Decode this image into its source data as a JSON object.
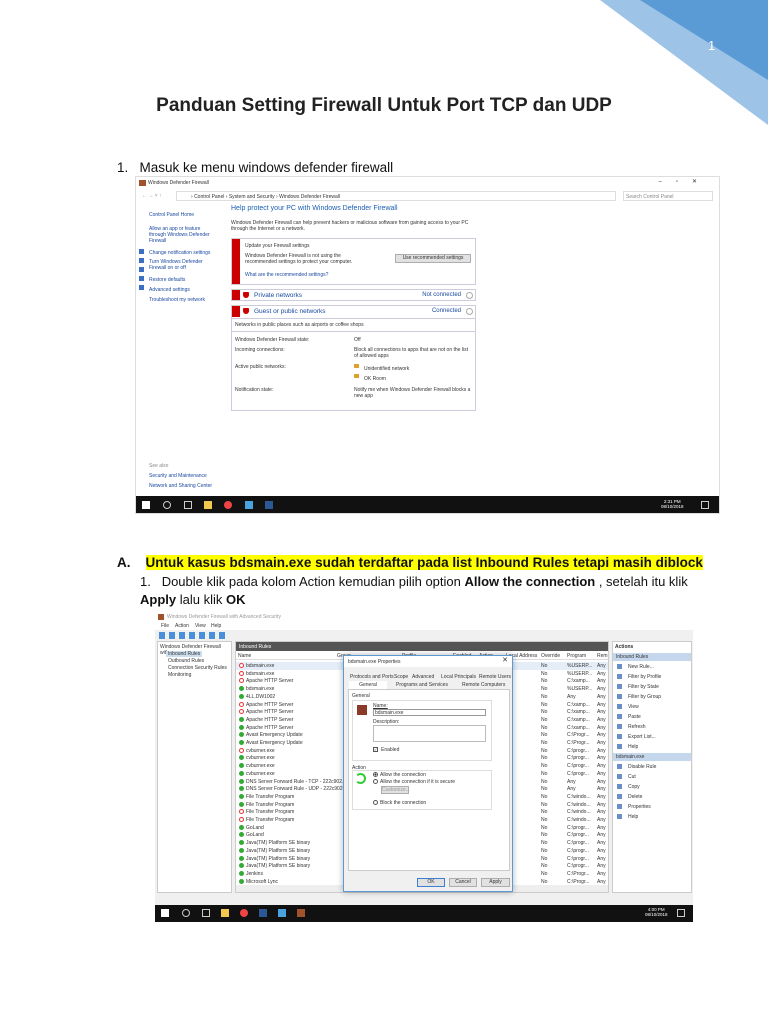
{
  "page_number": "1",
  "title": "Panduan Setting Firewall Untuk Port TCP dan UDP",
  "step1": {
    "num": "1.",
    "text": "Masuk ke menu windows defender firewall"
  },
  "shot1": {
    "window_title": "Windows Defender Firewall",
    "breadcrumb": [
      "Control Panel",
      "System and Security",
      "Windows Defender Firewall"
    ],
    "search_placeholder": "Search Control Panel",
    "window_controls": [
      "–",
      "▫",
      "✕"
    ],
    "left_links": [
      "Control Panel Home",
      "Allow an app or feature through Windows Defender Firewall",
      "Change notification settings",
      "Turn Windows Defender Firewall on or off",
      "Restore defaults",
      "Advanced settings",
      "Troubleshoot my network"
    ],
    "see_also": "See also",
    "see_also_links": [
      "Security and Maintenance",
      "Network and Sharing Center"
    ],
    "heading": "Help protect your PC with Windows Defender Firewall",
    "intro": "Windows Defender Firewall can help prevent hackers or malicious software from gaining access to your PC through the Internet or a network.",
    "warn_title": "Update your Firewall settings",
    "warn_text": "Windows Defender Firewall is not using the recommended settings to protect your computer.",
    "warn_button": "Use recommended settings",
    "warn_link": "What are the recommended settings?",
    "private": {
      "label": "Private networks",
      "status": "Not connected"
    },
    "public": {
      "label": "Guest or public networks",
      "status": "Connected"
    },
    "public_desc": "Networks in public places such as airports or coffee shops",
    "details": [
      {
        "k": "Windows Defender Firewall state:",
        "v": "Off"
      },
      {
        "k": "Incoming connections:",
        "v": "Block all connections to apps that are not on the list of allowed apps"
      },
      {
        "k": "Active public networks:",
        "v": "Unidentified network"
      },
      {
        "k": "",
        "v": "OK Room"
      },
      {
        "k": "Notification state:",
        "v": "Notify me when Windows Defender Firewall blocks a new app"
      }
    ],
    "clock": {
      "time": "2:31 PM",
      "date": "08/10/2018"
    }
  },
  "sectionA": {
    "letter": "A.",
    "text": "Untuk kasus bdsmain.exe sudah terdaftar pada list Inbound Rules tetapi masih diblock"
  },
  "stepA1": {
    "num": "1.",
    "t1": "Double klik pada kolom Action kemudian pilih option ",
    "b1": "Allow the connection",
    "t2": " , setelah itu klik ",
    "b2": "Apply",
    "t3": " lalu klik ",
    "b3": "OK"
  },
  "shot2": {
    "window_title": "Windows Defender Firewall with Advanced Security",
    "menu": [
      "File",
      "Action",
      "View",
      "Help"
    ],
    "tree": [
      "Windows Defender Firewall with",
      "Inbound Rules",
      "Outbound Rules",
      "Connection Security Rules",
      "Monitoring"
    ],
    "pane_title": "Inbound Rules",
    "columns": [
      "Name",
      "Group",
      "Profile",
      "Enabled",
      "Action",
      "Local Address",
      "Override",
      "Program",
      "Rem"
    ],
    "rules": [
      {
        "name": "bdsmain.exe",
        "s": "block",
        "prog": "%USERP..."
      },
      {
        "name": "bdsmain.exe",
        "s": "block",
        "prog": "%USERP..."
      },
      {
        "name": "Apache HTTP Server",
        "s": "block",
        "prog": "C:\\xamp..."
      },
      {
        "name": "bdsmain.exe",
        "s": "allow",
        "prog": "%USERP..."
      },
      {
        "name": "4LL.DW1002",
        "s": "allow",
        "prog": "Any"
      },
      {
        "name": "Apache HTTP Server",
        "s": "block",
        "prog": "C:\\xamp..."
      },
      {
        "name": "Apache HTTP Server",
        "s": "block",
        "prog": "C:\\xamp..."
      },
      {
        "name": "Apache HTTP Server",
        "s": "allow",
        "prog": "C:\\xamp..."
      },
      {
        "name": "Apache HTTP Server",
        "s": "allow",
        "prog": "C:\\xamp..."
      },
      {
        "name": "Avast Emergency Update",
        "s": "allow",
        "prog": "C:\\Progr..."
      },
      {
        "name": "Avast Emergency Update",
        "s": "allow",
        "prog": "C:\\Progr..."
      },
      {
        "name": "cvburner.exe",
        "s": "block",
        "prog": "C:\\progr..."
      },
      {
        "name": "cvburner.exe",
        "s": "allow",
        "prog": "C:\\progr..."
      },
      {
        "name": "cvburner.exe",
        "s": "allow",
        "prog": "C:\\progr..."
      },
      {
        "name": "cvburner.exe",
        "s": "allow",
        "prog": "C:\\progr..."
      },
      {
        "name": "DNS Server Forward Rule - TCP - 222c902...",
        "s": "allow",
        "prog": "Any"
      },
      {
        "name": "DNS Server Forward Rule - UDP - 222c902...",
        "s": "allow",
        "prog": "Any"
      },
      {
        "name": "File Transfer Program",
        "s": "allow",
        "prog": "C:\\windo..."
      },
      {
        "name": "File Transfer Program",
        "s": "allow",
        "prog": "C:\\windo..."
      },
      {
        "name": "File Transfer Program",
        "s": "block",
        "prog": "C:\\windo..."
      },
      {
        "name": "File Transfer Program",
        "s": "block",
        "prog": "C:\\windo..."
      },
      {
        "name": "GoLand",
        "s": "allow",
        "prog": "C:\\progr..."
      },
      {
        "name": "GoLand",
        "s": "allow",
        "prog": "C:\\progr..."
      },
      {
        "name": "Java(TM) Platform SE binary",
        "s": "allow",
        "prog": "C:\\progr..."
      },
      {
        "name": "Java(TM) Platform SE binary",
        "s": "allow",
        "prog": "C:\\progr..."
      },
      {
        "name": "Java(TM) Platform SE binary",
        "s": "allow",
        "prog": "C:\\progr..."
      },
      {
        "name": "Java(TM) Platform SE binary",
        "s": "allow",
        "prog": "C:\\progr..."
      },
      {
        "name": "Jenkins",
        "s": "allow",
        "prog": "C:\\Progr..."
      },
      {
        "name": "Microsoft Lync",
        "s": "allow",
        "prog": "C:\\Progr..."
      }
    ],
    "override": "No",
    "remote": "Any",
    "actions_title": "Actions",
    "actions_group1": "Inbound Rules",
    "actions1": [
      "New Rule...",
      "Filter by Profile",
      "Filter by State",
      "Filter by Group",
      "View",
      "Paste",
      "Refresh",
      "Export List...",
      "Help"
    ],
    "actions_group2": "bdsmain.exe",
    "actions2": [
      "Disable Rule",
      "Cut",
      "Copy",
      "Delete",
      "Properties",
      "Help"
    ],
    "dialog": {
      "title": "bdsmain.exe Properties",
      "tabs_row1": [
        "Protocols and Ports",
        "Scope",
        "Advanced",
        "Local Principals",
        "Remote Users"
      ],
      "tabs_row2": [
        "General",
        "Programs and Services",
        "Remote Computers"
      ],
      "general_label": "General",
      "name_label": "Name:",
      "name_value": "bdsmain.exe",
      "desc_label": "Description:",
      "enabled_label": "Enabled",
      "action_label": "Action",
      "options": [
        "Allow the connection",
        "Allow the connection if it is secure",
        "Block the connection"
      ],
      "customize": "Customize...",
      "ok": "OK",
      "cancel": "Cancel",
      "apply": "Apply"
    },
    "clock": {
      "time": "4:00 PM",
      "date": "08/10/2018"
    }
  }
}
